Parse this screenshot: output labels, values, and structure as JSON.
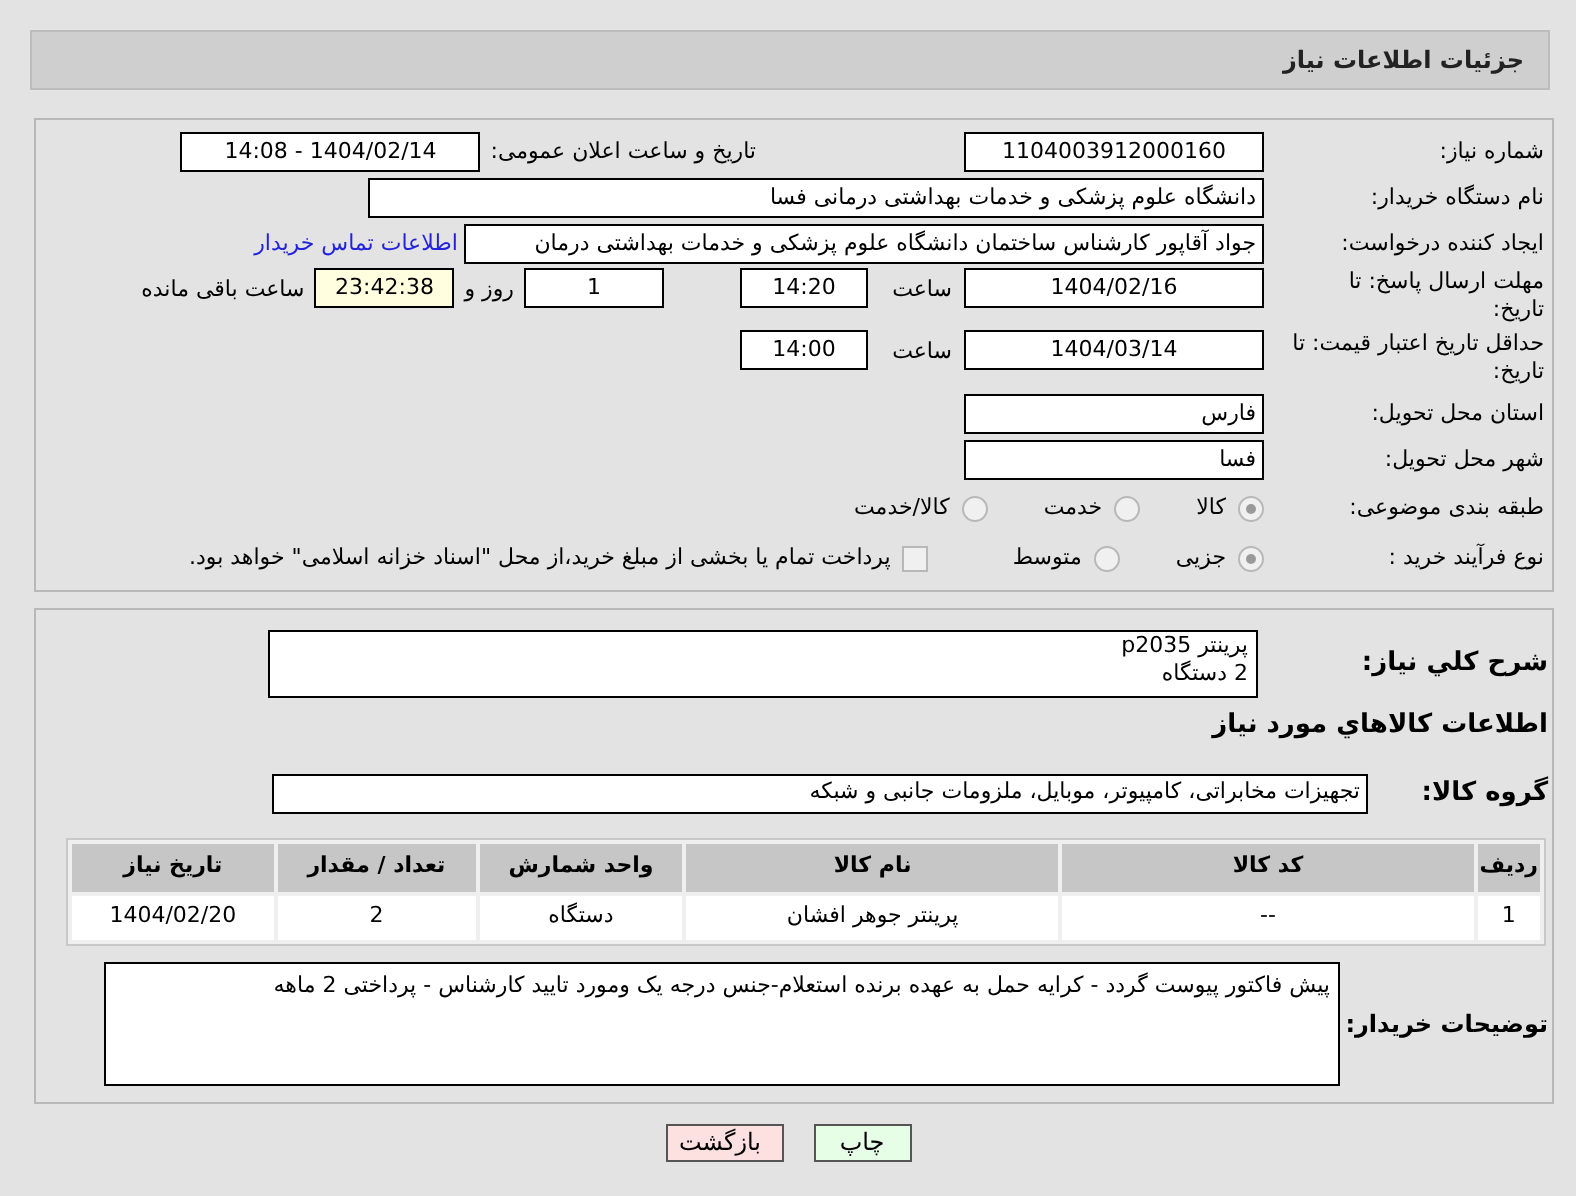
{
  "header": {
    "title": "جزئیات اطلاعات نیاز"
  },
  "details": {
    "need_number": {
      "label": "شماره نیاز:",
      "value": "1104003912000160"
    },
    "announce": {
      "label": "تاریخ و ساعت اعلان عمومی:",
      "value": "1404/02/14 - 14:08"
    },
    "buyer_org": {
      "label": "نام دستگاه خریدار:",
      "value": "دانشگاه علوم پزشکی و خدمات بهداشتی درمانی فسا"
    },
    "requester": {
      "label": "ایجاد کننده درخواست:",
      "value": "جواد آقاپور کارشناس ساختمان دانشگاه علوم پزشکی و خدمات بهداشتی درمان",
      "link": "اطلاعات تماس خریدار"
    },
    "reply_deadline": {
      "label": "مهلت ارسال پاسخ: تا تاریخ:",
      "date": "1404/02/16",
      "time_label": "ساعت",
      "time": "14:20",
      "days": "1",
      "days_label": "روز و",
      "remaining": "23:42:38",
      "remaining_label": "ساعت باقی مانده"
    },
    "price_validity": {
      "label": "حداقل تاریخ اعتبار قیمت: تا تاریخ:",
      "date": "1404/03/14",
      "time_label": "ساعت",
      "time": "14:00"
    },
    "province": {
      "label": "استان محل تحویل:",
      "value": "فارس"
    },
    "city": {
      "label": "شهر محل تحویل:",
      "value": "فسا"
    },
    "category": {
      "label": "طبقه بندی موضوعی:",
      "options": [
        {
          "label": "کالا",
          "selected": true
        },
        {
          "label": "خدمت",
          "selected": false
        },
        {
          "label": "کالا/خدمت",
          "selected": false
        }
      ]
    },
    "process": {
      "label": "نوع فرآیند خرید :",
      "options": [
        {
          "label": "جزیی",
          "selected": true
        },
        {
          "label": "متوسط",
          "selected": false
        }
      ],
      "payment": {
        "label": "پرداخت تمام یا بخشی از مبلغ خرید،از محل \"اسناد خزانه اسلامی\" خواهد بود.",
        "checked": false
      }
    }
  },
  "goods": {
    "summary": {
      "label": "شرح کلي نياز:",
      "lines": [
        "پرینتر p2035",
        "2 دستگاه"
      ]
    },
    "heading": "اطلاعات کالاهاي مورد نياز",
    "group": {
      "label": "گروه کالا:",
      "value": "تجهیزات مخابراتی، کامپیوتر، موبایل، ملزومات جانبی و شبکه"
    },
    "table": {
      "columns": [
        "ردیف",
        "کد کالا",
        "نام کالا",
        "واحد شمارش",
        "تعداد / مقدار",
        "تاریخ نیاز"
      ],
      "rows": [
        [
          "1",
          "--",
          "پرینتر جوهر افشان",
          "دستگاه",
          "2",
          "1404/02/20"
        ]
      ]
    },
    "notes": {
      "label": "توضیحات خریدار:",
      "value": "پیش فاکتور پیوست گردد - کرایه حمل به عهده برنده استعلام-جنس درجه یک ومورد تایید کارشناس - پرداختی 2 ماهه"
    }
  },
  "buttons": [
    {
      "label": "چاپ",
      "kind": "print"
    },
    {
      "label": "بازگشت",
      "kind": "back"
    }
  ]
}
